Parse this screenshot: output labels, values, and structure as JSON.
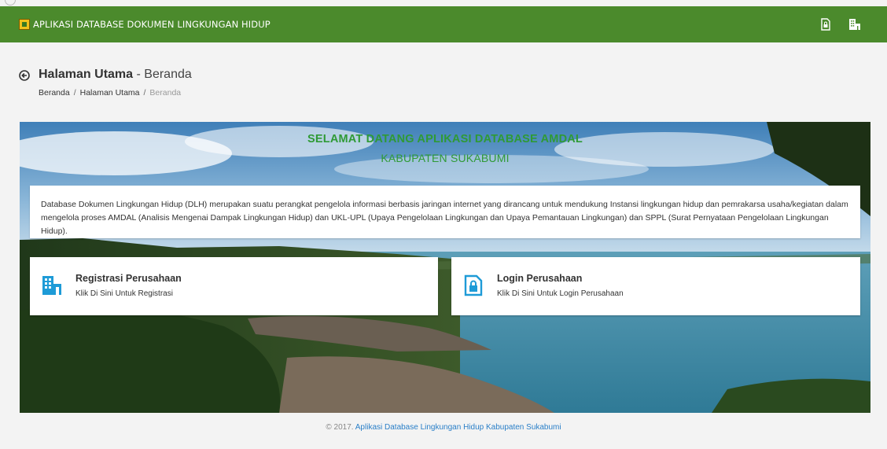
{
  "navbar": {
    "app_title": "APLIKASI DATABASE DOKUMEN LINGKUNGAN HIDUP",
    "icons": [
      "logo-icon",
      "login-icon",
      "building-icon"
    ],
    "bg_color": "#4b8a2c"
  },
  "page": {
    "title_bold": "Halaman Utama",
    "title_rest": "- Beranda",
    "breadcrumb": [
      "Beranda",
      "Halaman Utama",
      "Beranda"
    ],
    "breadcrumb_sep": "/"
  },
  "hero": {
    "title": "SELAMAT DATANG APLIKASI DATABASE AMDAL",
    "subtitle": "KABUPATEN SUKABUMI",
    "title_color": "#2f9a35",
    "description": "Database Dokumen Lingkungan Hidup (DLH) merupakan suatu perangkat pengelola informasi berbasis jaringan internet yang dirancang untuk mendukung Instansi lingkungan hidup dan pemrakarsa usaha/kegiatan dalam mengelola proses AMDAL (Analisis Mengenai Dampak Lingkungan Hidup) dan UKL-UPL (Upaya Pengelolaan Lingkungan dan Upaya Pemantauan Lingkungan) dan SPPL (Surat Pernyataan Pengelolaan Lingkungan Hidup)."
  },
  "cards": {
    "register": {
      "title": "Registrasi Perusahaan",
      "subtitle": "Klik Di Sini Untuk Registrasi",
      "icon": "building-icon"
    },
    "login": {
      "title": "Login Perusahaan",
      "subtitle": "Klik Di Sini Untuk Login Perusahaan",
      "icon": "document-lock-icon"
    },
    "icon_color": "#1e9bd7"
  },
  "footer": {
    "copyright": "© 2017.",
    "link": "Aplikasi Database Lingkungan Hidup Kabupaten Sukabumi",
    "link_color": "#2a7fc8"
  }
}
